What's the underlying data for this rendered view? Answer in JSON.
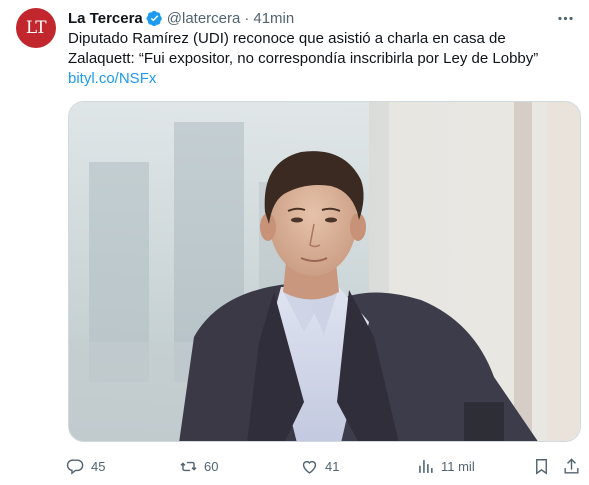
{
  "tweet": {
    "avatar_text": "LT",
    "display_name": "La Tercera",
    "handle": "@latercera",
    "separator": "·",
    "time": "41min",
    "text_line1": "Diputado Ramírez (UDI) reconoce que asistió a charla en casa de",
    "text_line2": "Zalaquett: “Fui expositor, no correspondía inscribirla por Ley de Lobby”",
    "link": "bityl.co/NSFx"
  },
  "actions": {
    "replies": "45",
    "reposts": "60",
    "likes": "41",
    "views": "11 mil"
  },
  "icons": [
    "verified-badge-icon",
    "more-icon",
    "reply-icon",
    "repost-icon",
    "like-icon",
    "views-icon",
    "bookmark-icon",
    "share-icon"
  ],
  "colors": {
    "avatar_bg": "#c1272d",
    "verified": "#1d9bf0",
    "link": "#1d9bf0",
    "muted": "#536471",
    "text": "#0f1419"
  }
}
